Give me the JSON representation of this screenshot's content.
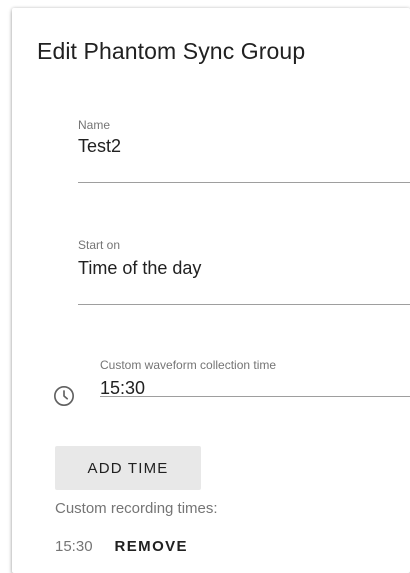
{
  "dialog": {
    "title": "Edit Phantom Sync Group"
  },
  "fields": {
    "name": {
      "label": "Name",
      "value": "Test2"
    },
    "start_on": {
      "label": "Start on",
      "value": "Time of the day"
    },
    "collection_time": {
      "label": "Custom waveform collection time",
      "value": "15:30",
      "icon": "clock-icon"
    }
  },
  "actions": {
    "add_time_label": "ADD TIME"
  },
  "recording": {
    "label": "Custom recording times:",
    "items": [
      {
        "time": "15:30",
        "remove_label": "REMOVE"
      }
    ]
  },
  "colors": {
    "text_primary": "#212121",
    "text_secondary": "#757575",
    "underline": "#9e9e9e",
    "button_bg": "#e8e8e8"
  }
}
